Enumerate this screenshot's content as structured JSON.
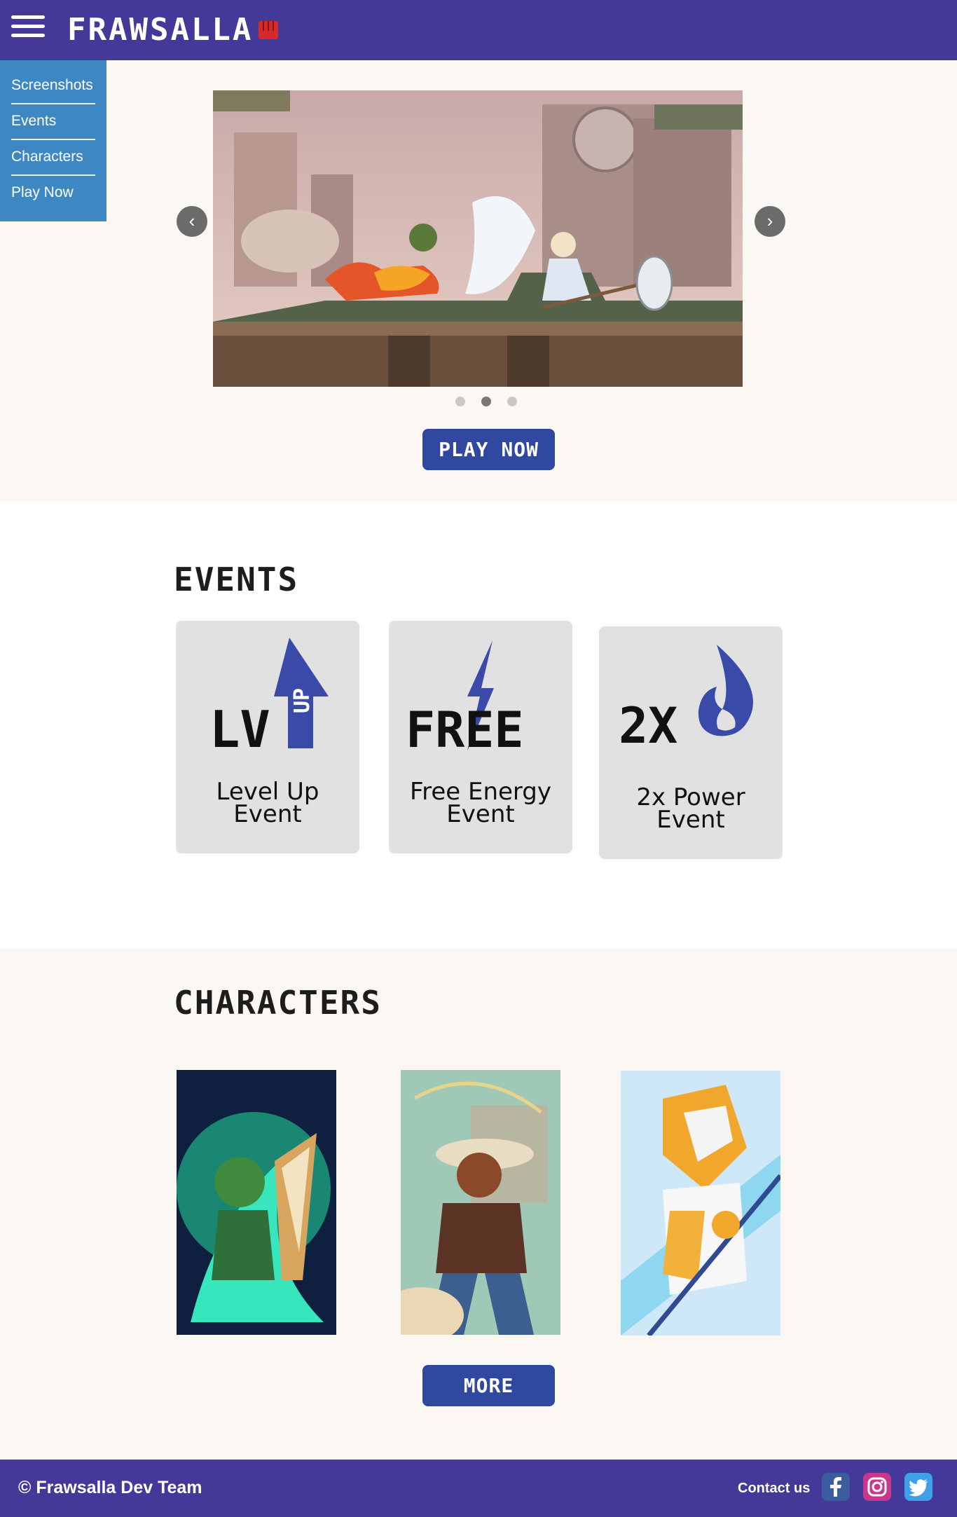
{
  "header": {
    "logo_text": "FRAWSALLA",
    "menu_icon": "hamburger-menu-icon",
    "logo_icon": "red-fist-icon"
  },
  "nav": {
    "items": [
      {
        "label": "Screenshots"
      },
      {
        "label": "Events"
      },
      {
        "label": "Characters"
      },
      {
        "label": "Play Now"
      }
    ]
  },
  "hero": {
    "prev_icon": "chevron-left-icon",
    "next_icon": "chevron-right-icon",
    "slide_count": 3,
    "active_slide": 2,
    "play_label": "PLAY NOW"
  },
  "events": {
    "title": "EVENTS",
    "cards": [
      {
        "icon_text": "LV",
        "badge": "UP",
        "label_line1": "Level Up",
        "label_line2": "Event"
      },
      {
        "icon_text": "FREE",
        "label_line1": "Free Energy",
        "label_line2": "Event"
      },
      {
        "icon_text": "2X",
        "label_line1": "2x Power",
        "label_line2": "Event"
      }
    ]
  },
  "characters": {
    "title": "CHARACTERS",
    "more_label": "MORE"
  },
  "footer": {
    "copyright": "© Frawsalla Dev Team",
    "contact_label": "Contact us",
    "social_icons": [
      "facebook-icon",
      "instagram-icon",
      "twitter-icon"
    ]
  },
  "colors": {
    "header_bg": "#443998",
    "menu_bg": "#3d87c2",
    "button_bg": "#3048a0",
    "card_bg": "#e1e1e1",
    "accent_blue": "#3a4aa8"
  }
}
